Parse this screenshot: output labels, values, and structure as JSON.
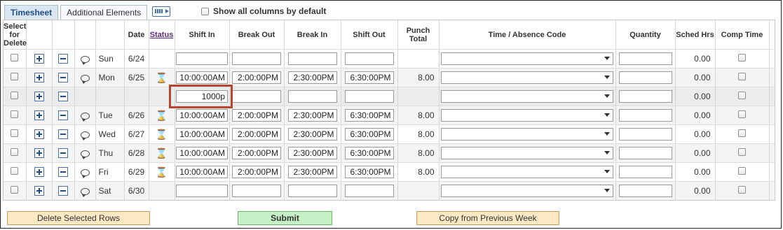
{
  "tabs": {
    "timesheet": "Timesheet",
    "additional": "Additional Elements"
  },
  "show_all": {
    "label": "Show all columns by default"
  },
  "headers": {
    "select": [
      "Select",
      "for",
      "Delete"
    ],
    "date": "Date",
    "status": "Status",
    "shift_in": "Shift In",
    "break_out": "Break Out",
    "break_in": "Break In",
    "shift_out": "Shift Out",
    "punch_total": [
      "Punch",
      "Total"
    ],
    "time_code": "Time / Absence Code",
    "quantity": "Quantity",
    "sched_hrs": "Sched Hrs",
    "comp_time": "Comp Time"
  },
  "rows": [
    {
      "day": "Sun",
      "date": "6/24",
      "status": "",
      "shift_in": "",
      "break_out": "",
      "break_in": "",
      "shift_out": "",
      "punch_total": "",
      "sched": "0.00"
    },
    {
      "day": "Mon",
      "date": "6/25",
      "status": "⌛",
      "shift_in": "10:00:00AM",
      "break_out": "2:00:00PM",
      "break_in": "2:30:00PM",
      "shift_out": "6:30:00PM",
      "punch_total": "8.00",
      "sched": "0.00"
    },
    {
      "day": "",
      "date": "",
      "status": "",
      "shift_in": "1000p",
      "break_out": "",
      "break_in": "",
      "shift_out": "",
      "punch_total": "",
      "sched": "0.00"
    },
    {
      "day": "Tue",
      "date": "6/26",
      "status": "⌛",
      "shift_in": "10:00:00AM",
      "break_out": "2:00:00PM",
      "break_in": "2:30:00PM",
      "shift_out": "6:30:00PM",
      "punch_total": "8.00",
      "sched": "0.00"
    },
    {
      "day": "Wed",
      "date": "6/27",
      "status": "⌛",
      "shift_in": "10:00:00AM",
      "break_out": "2:00:00PM",
      "break_in": "2:30:00PM",
      "shift_out": "6:30:00PM",
      "punch_total": "8.00",
      "sched": "0.00"
    },
    {
      "day": "Thu",
      "date": "6/28",
      "status": "⌛",
      "shift_in": "10:00:00AM",
      "break_out": "2:00:00PM",
      "break_in": "2:30:00PM",
      "shift_out": "6:30:00PM",
      "punch_total": "8.00",
      "sched": "0.00"
    },
    {
      "day": "Fri",
      "date": "6/29",
      "status": "⌛",
      "shift_in": "10:00:00AM",
      "break_out": "2:00:00PM",
      "break_in": "2:30:00PM",
      "shift_out": "6:30:00PM",
      "punch_total": "8.00",
      "sched": "0.00"
    },
    {
      "day": "Sat",
      "date": "6/30",
      "status": "",
      "shift_in": "",
      "break_out": "",
      "break_in": "",
      "shift_out": "",
      "punch_total": "",
      "sched": "0.00"
    }
  ],
  "buttons": {
    "delete": "Delete Selected Rows",
    "submit": "Submit",
    "copy": "Copy from Previous Week"
  }
}
